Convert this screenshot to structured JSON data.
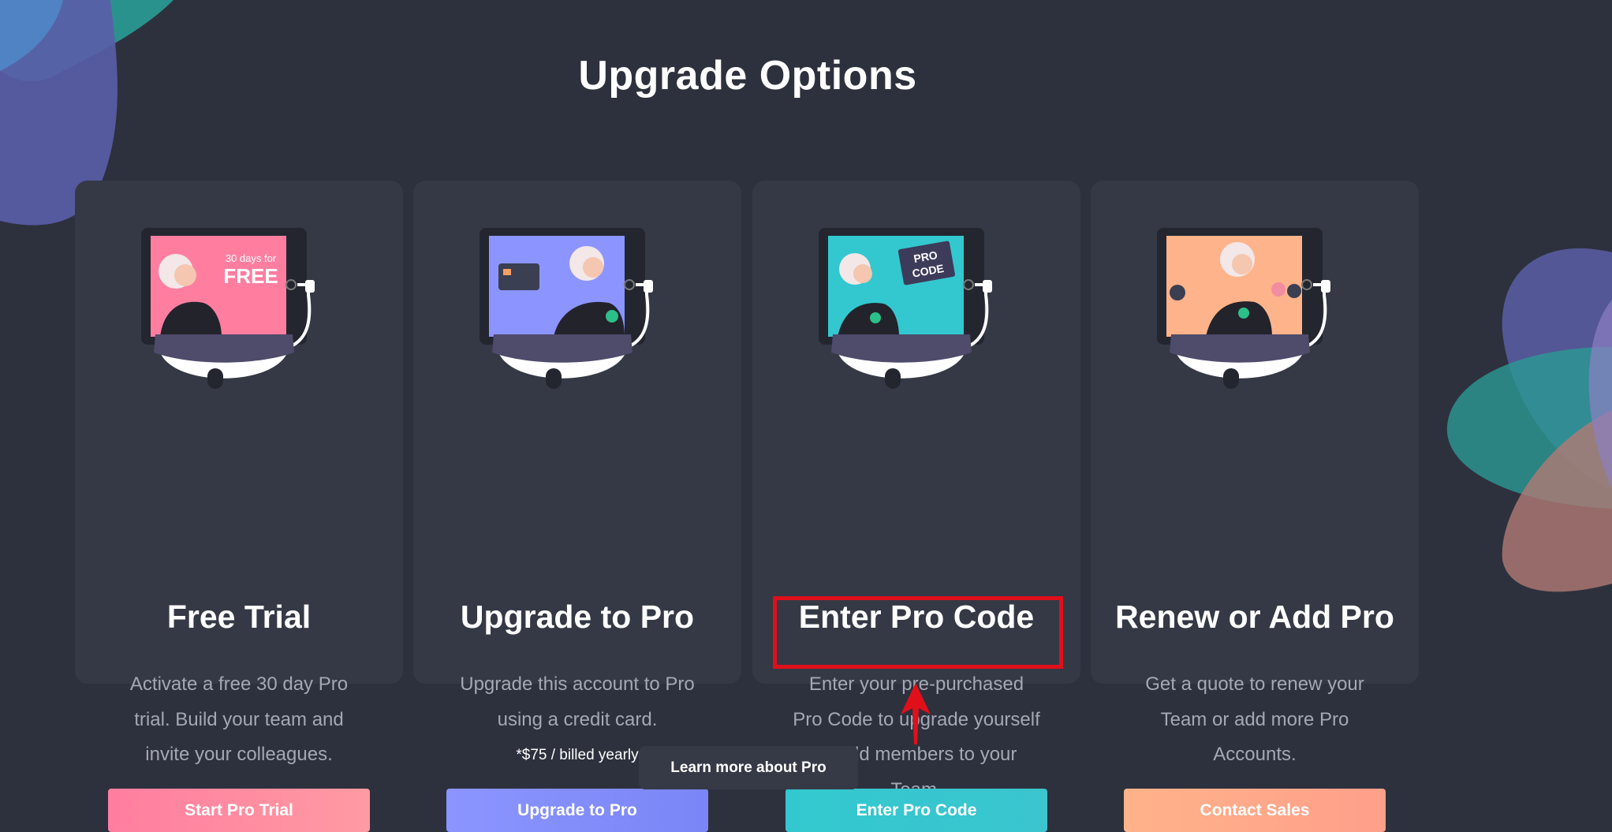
{
  "page": {
    "title": "Upgrade Options",
    "learn_more_label": "Learn more about Pro"
  },
  "cards": [
    {
      "title": "Free Trial",
      "description": "Activate a free 30 day Pro trial. Build your team and invite your colleagues.",
      "button_label": "Start Pro Trial",
      "screen_text_top": "30 days for",
      "screen_text_main": "FREE",
      "accent_colors": [
        "#ff7ea0",
        "#ff9aa2"
      ]
    },
    {
      "title": "Upgrade to Pro",
      "description": "Upgrade this account to Pro using a credit card.",
      "price_note": "*$75 / billed yearly",
      "button_label": "Upgrade to Pro",
      "accent_colors": [
        "#8c95ff",
        "#7a86f6"
      ]
    },
    {
      "title": "Enter Pro Code",
      "description": "Enter your pre-purchased Pro Code to upgrade yourself or add members to your Team.",
      "button_label": "Enter Pro Code",
      "screen_text_top": "PRO",
      "screen_text_main": "CODE",
      "accent_colors": [
        "#33c8cf",
        "#3ac5cf"
      ]
    },
    {
      "title": "Renew or Add Pro",
      "description": "Get a quote to renew your Team or add more Pro Accounts.",
      "button_label": "Contact Sales",
      "accent_colors": [
        "#ffb38a",
        "#ff9f8a"
      ]
    }
  ],
  "annotation": {
    "highlight_color": "#e0101a",
    "target": "Enter Pro Code"
  }
}
